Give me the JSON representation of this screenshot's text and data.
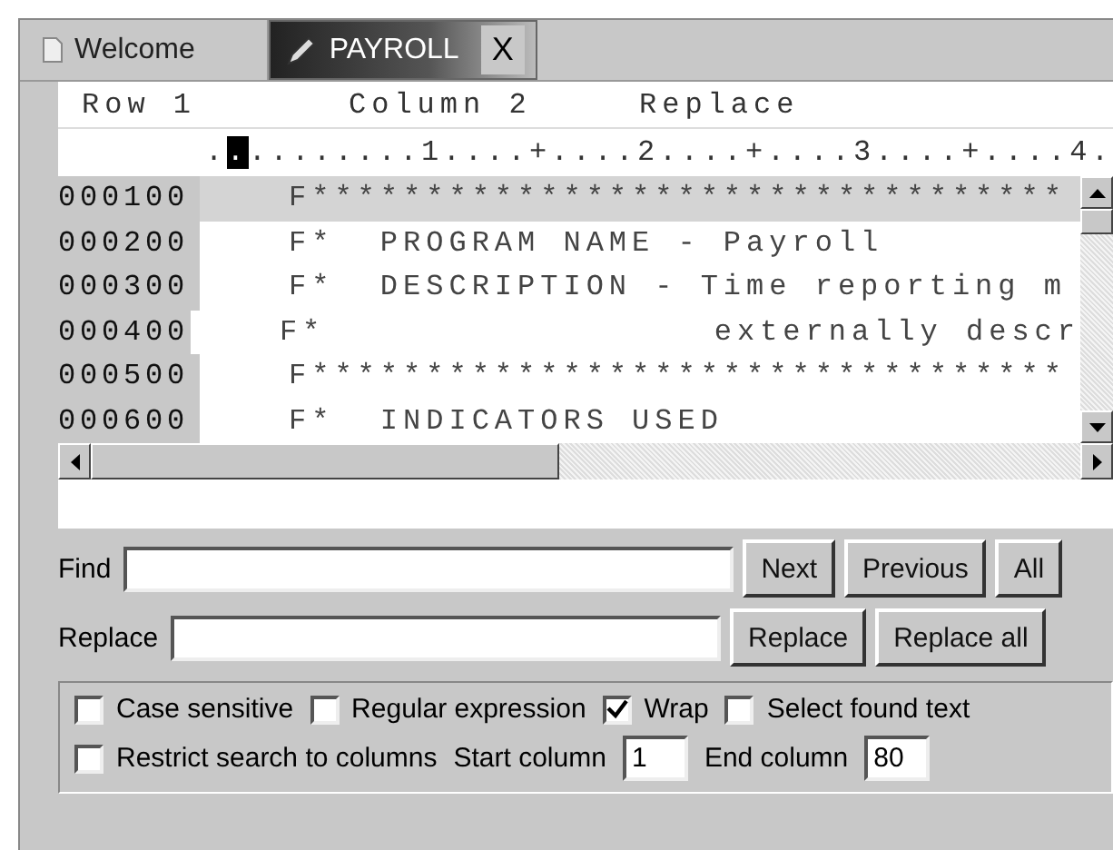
{
  "tabs": [
    {
      "label": "Welcome",
      "selected": false
    },
    {
      "label": "PAYROLL",
      "selected": true,
      "close": "X"
    }
  ],
  "editor": {
    "status": {
      "row": "Row 1",
      "column": "Column 2",
      "mode": "Replace"
    },
    "ruler": {
      "before": ".",
      "cursor": ".",
      "after": "........1....+....2....+....3....+....4."
    },
    "lines": [
      {
        "number": "000100",
        "text": "F*********************************",
        "selected": true
      },
      {
        "number": "000200",
        "text": "F*  PROGRAM NAME - Payroll",
        "selected": false
      },
      {
        "number": "000300",
        "text": "F*  DESCRIPTION - Time reporting m",
        "selected": false
      },
      {
        "number": "000400",
        "text": "F*                 externally descr",
        "selected": false
      },
      {
        "number": "000500",
        "text": "F*********************************",
        "selected": false
      },
      {
        "number": "000600",
        "text": "F*  INDICATORS USED",
        "selected": false
      }
    ]
  },
  "find": {
    "label": "Find",
    "buttons": [
      "Next",
      "Previous",
      "All"
    ]
  },
  "replace": {
    "label": "Replace",
    "buttons": [
      "Replace",
      "Replace all"
    ]
  },
  "options": [
    {
      "label": "Case sensitive",
      "checked": false
    },
    {
      "label": "Regular expression",
      "checked": false
    },
    {
      "label": "Wrap",
      "checked": true
    },
    {
      "label": "Select found text",
      "checked": false
    }
  ],
  "columns": {
    "restrict": {
      "label": "Restrict search to columns",
      "checked": false
    },
    "start_label": "Start column",
    "start_value": "1",
    "end_label": "End column",
    "end_value": "80"
  }
}
